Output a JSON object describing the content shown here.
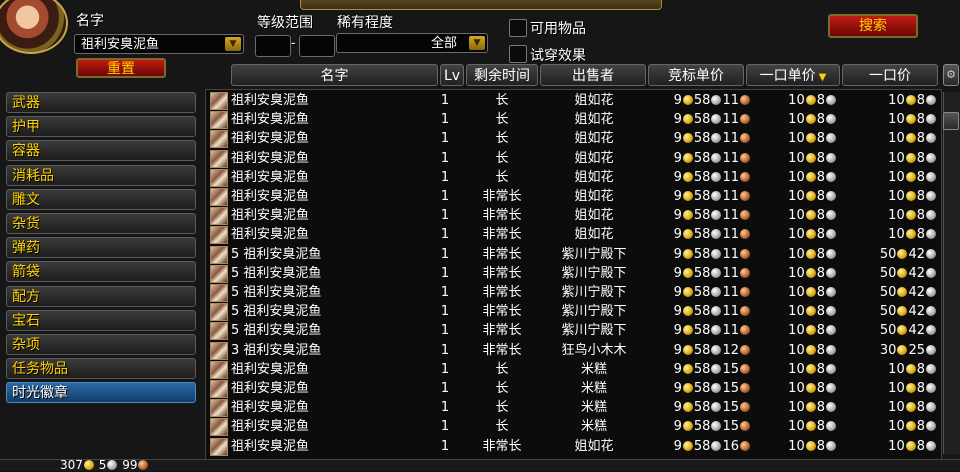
{
  "filters": {
    "name_label": "名字",
    "name_value": "祖利安臭泥鱼",
    "level_label": "等级范围",
    "level_sep": "-",
    "rarity_label": "稀有程度",
    "rarity_value": "全部",
    "usable_label": "可用物品",
    "preview_label": "试穿效果",
    "search_button": "搜索",
    "reset_button": "重置"
  },
  "categories": [
    "武器",
    "护甲",
    "容器",
    "消耗品",
    "雕文",
    "杂货",
    "弹药",
    "箭袋",
    "配方",
    "宝石",
    "杂项",
    "任务物品",
    "时光徽章"
  ],
  "selected_category": "时光徽章",
  "columns": {
    "name": "名字",
    "lv": "Lv",
    "time": "剩余时间",
    "seller": "出售者",
    "bid": "竞标单价",
    "buyout_unit": "一口单价",
    "buyout": "一口价"
  },
  "rows": [
    {
      "qty": "",
      "name": "祖利安臭泥鱼",
      "lv": "1",
      "time": "长",
      "seller": "姐如花",
      "bid": [
        "9",
        "58",
        "11"
      ],
      "unit": [
        "10",
        "8",
        ""
      ],
      "buyout": [
        "10",
        "8",
        ""
      ]
    },
    {
      "qty": "",
      "name": "祖利安臭泥鱼",
      "lv": "1",
      "time": "长",
      "seller": "姐如花",
      "bid": [
        "9",
        "58",
        "11"
      ],
      "unit": [
        "10",
        "8",
        ""
      ],
      "buyout": [
        "10",
        "8",
        ""
      ]
    },
    {
      "qty": "",
      "name": "祖利安臭泥鱼",
      "lv": "1",
      "time": "长",
      "seller": "姐如花",
      "bid": [
        "9",
        "58",
        "11"
      ],
      "unit": [
        "10",
        "8",
        ""
      ],
      "buyout": [
        "10",
        "8",
        ""
      ]
    },
    {
      "qty": "",
      "name": "祖利安臭泥鱼",
      "lv": "1",
      "time": "长",
      "seller": "姐如花",
      "bid": [
        "9",
        "58",
        "11"
      ],
      "unit": [
        "10",
        "8",
        ""
      ],
      "buyout": [
        "10",
        "8",
        ""
      ]
    },
    {
      "qty": "",
      "name": "祖利安臭泥鱼",
      "lv": "1",
      "time": "长",
      "seller": "姐如花",
      "bid": [
        "9",
        "58",
        "11"
      ],
      "unit": [
        "10",
        "8",
        ""
      ],
      "buyout": [
        "10",
        "8",
        ""
      ]
    },
    {
      "qty": "",
      "name": "祖利安臭泥鱼",
      "lv": "1",
      "time": "非常长",
      "seller": "姐如花",
      "bid": [
        "9",
        "58",
        "11"
      ],
      "unit": [
        "10",
        "8",
        ""
      ],
      "buyout": [
        "10",
        "8",
        ""
      ]
    },
    {
      "qty": "",
      "name": "祖利安臭泥鱼",
      "lv": "1",
      "time": "非常长",
      "seller": "姐如花",
      "bid": [
        "9",
        "58",
        "11"
      ],
      "unit": [
        "10",
        "8",
        ""
      ],
      "buyout": [
        "10",
        "8",
        ""
      ]
    },
    {
      "qty": "",
      "name": "祖利安臭泥鱼",
      "lv": "1",
      "time": "非常长",
      "seller": "姐如花",
      "bid": [
        "9",
        "58",
        "11"
      ],
      "unit": [
        "10",
        "8",
        ""
      ],
      "buyout": [
        "10",
        "8",
        ""
      ]
    },
    {
      "qty": "5",
      "name": "祖利安臭泥鱼",
      "lv": "1",
      "time": "非常长",
      "seller": "紫川宁殿下",
      "bid": [
        "9",
        "58",
        "11"
      ],
      "unit": [
        "10",
        "8",
        ""
      ],
      "buyout": [
        "50",
        "42",
        ""
      ]
    },
    {
      "qty": "5",
      "name": "祖利安臭泥鱼",
      "lv": "1",
      "time": "非常长",
      "seller": "紫川宁殿下",
      "bid": [
        "9",
        "58",
        "11"
      ],
      "unit": [
        "10",
        "8",
        ""
      ],
      "buyout": [
        "50",
        "42",
        ""
      ]
    },
    {
      "qty": "5",
      "name": "祖利安臭泥鱼",
      "lv": "1",
      "time": "非常长",
      "seller": "紫川宁殿下",
      "bid": [
        "9",
        "58",
        "11"
      ],
      "unit": [
        "10",
        "8",
        ""
      ],
      "buyout": [
        "50",
        "42",
        ""
      ]
    },
    {
      "qty": "5",
      "name": "祖利安臭泥鱼",
      "lv": "1",
      "time": "非常长",
      "seller": "紫川宁殿下",
      "bid": [
        "9",
        "58",
        "11"
      ],
      "unit": [
        "10",
        "8",
        ""
      ],
      "buyout": [
        "50",
        "42",
        ""
      ]
    },
    {
      "qty": "5",
      "name": "祖利安臭泥鱼",
      "lv": "1",
      "time": "非常长",
      "seller": "紫川宁殿下",
      "bid": [
        "9",
        "58",
        "11"
      ],
      "unit": [
        "10",
        "8",
        ""
      ],
      "buyout": [
        "50",
        "42",
        ""
      ]
    },
    {
      "qty": "3",
      "name": "祖利安臭泥鱼",
      "lv": "1",
      "time": "非常长",
      "seller": "狂鸟小木木",
      "bid": [
        "9",
        "58",
        "12"
      ],
      "unit": [
        "10",
        "8",
        ""
      ],
      "buyout": [
        "30",
        "25",
        ""
      ]
    },
    {
      "qty": "",
      "name": "祖利安臭泥鱼",
      "lv": "1",
      "time": "长",
      "seller": "米糕",
      "bid": [
        "9",
        "58",
        "15"
      ],
      "unit": [
        "10",
        "8",
        ""
      ],
      "buyout": [
        "10",
        "8",
        ""
      ]
    },
    {
      "qty": "",
      "name": "祖利安臭泥鱼",
      "lv": "1",
      "time": "长",
      "seller": "米糕",
      "bid": [
        "9",
        "58",
        "15"
      ],
      "unit": [
        "10",
        "8",
        ""
      ],
      "buyout": [
        "10",
        "8",
        ""
      ]
    },
    {
      "qty": "",
      "name": "祖利安臭泥鱼",
      "lv": "1",
      "time": "长",
      "seller": "米糕",
      "bid": [
        "9",
        "58",
        "15"
      ],
      "unit": [
        "10",
        "8",
        ""
      ],
      "buyout": [
        "10",
        "8",
        ""
      ]
    },
    {
      "qty": "",
      "name": "祖利安臭泥鱼",
      "lv": "1",
      "time": "长",
      "seller": "米糕",
      "bid": [
        "9",
        "58",
        "15"
      ],
      "unit": [
        "10",
        "8",
        ""
      ],
      "buyout": [
        "10",
        "8",
        ""
      ]
    },
    {
      "qty": "",
      "name": "祖利安臭泥鱼",
      "lv": "1",
      "time": "非常长",
      "seller": "姐如花",
      "bid": [
        "9",
        "58",
        "16"
      ],
      "unit": [
        "10",
        "8",
        ""
      ],
      "buyout": [
        "10",
        "8",
        ""
      ]
    }
  ],
  "footer": {
    "money": [
      "307",
      "5",
      "99"
    ]
  }
}
